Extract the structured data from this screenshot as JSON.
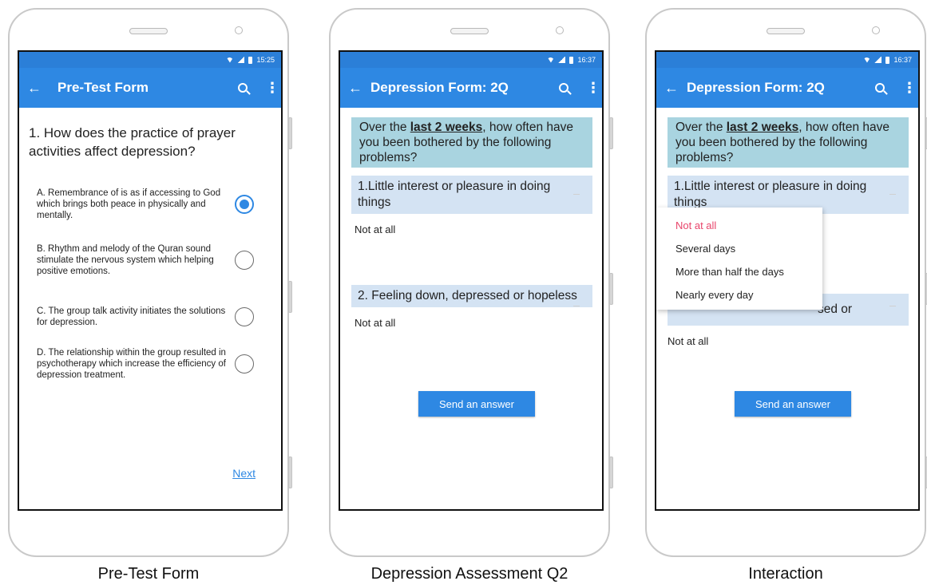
{
  "status": {
    "time_left": "15:25",
    "time_mid": "16:37",
    "time_right": "16:37"
  },
  "pretest": {
    "title": "Pre-Test Form",
    "question": "1.  How does the practice of prayer activities affect depression?",
    "options": [
      {
        "label": "A.  Remembrance of is as if accessing to God which brings both peace in physically and mentally.",
        "checked": true
      },
      {
        "label": "B.  Rhythm and melody of the Quran sound stimulate the nervous system which helping positive emotions.",
        "checked": false
      },
      {
        "label": "C.  The group talk activity initiates the solutions for depression.",
        "checked": false
      },
      {
        "label": "D.  The relationship within the group resulted in psychotherapy which increase the efficiency of depression treatment.",
        "checked": false
      }
    ],
    "next_label": "Next",
    "caption": "Pre-Test Form"
  },
  "depression": {
    "title": "Depression  Form: 2Q",
    "intro_pre": "Over the ",
    "intro_bold": "last 2 weeks",
    "intro_post": ", how often have you been bothered by the following problems?",
    "q1": "1.Little interest or pleasure in doing things",
    "q2": "2. Feeling down, depressed or hopeless",
    "a1": "Not at all",
    "a2": "Not at all",
    "send_label": "Send an answer",
    "caption": "Depression Assessment Q2"
  },
  "interaction": {
    "title": "Depression  Form: 2Q",
    "q2_visible": "sed or",
    "dropdown_options": [
      "Not at all",
      "Several days",
      "More than half the days",
      "Nearly every day"
    ],
    "selected_color": "#e8456b",
    "caption": "Interaction"
  },
  "colors": {
    "appbar": "#2e88e3",
    "statusbar": "#2b7fd8",
    "intro_bg": "#a9d4e0",
    "question_bg": "#d4e3f3"
  },
  "icons": {
    "back": "arrow-left-icon",
    "search": "search-icon",
    "more": "more-vert-icon"
  }
}
